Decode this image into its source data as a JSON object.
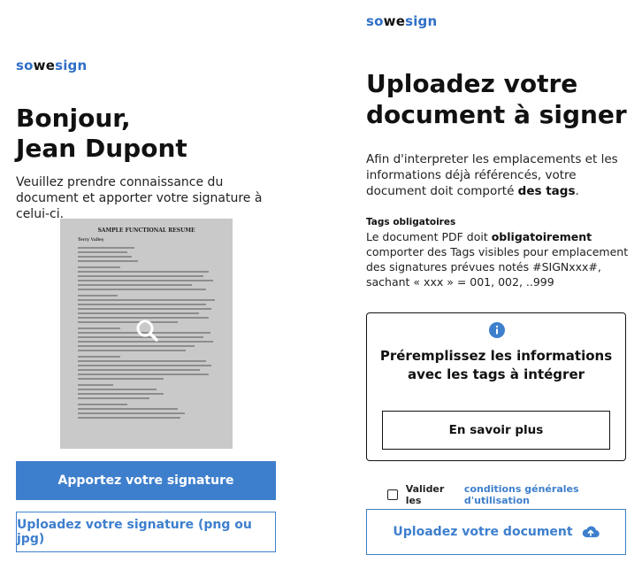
{
  "left": {
    "logo": {
      "so": "so",
      "we": "we",
      "sign": "sign"
    },
    "greeting_line1": "Bonjour,",
    "greeting_line2": "Jean Dupont",
    "intro": "Veuillez prendre connaissance du document et apporter votre signature à celui-ci.",
    "doc_preview": {
      "title": "SAMPLE FUNCTIONAL RESUME",
      "name": "Terry Valley"
    },
    "btn_sign": "Apportez votre signature",
    "btn_upload_signature": "Uploadez votre signature (png ou jpg)"
  },
  "right": {
    "logo": {
      "so": "so",
      "we": "we",
      "sign": "sign"
    },
    "heading_line1": "Uploadez votre",
    "heading_line2": "document à signer",
    "body_part1": "Afin d'interpreter les emplacements et les informations déjà référencés, votre document doit comporté ",
    "body_bold": "des tags",
    "body_end": ".",
    "tags_title": "Tags obligatoires",
    "tags_part1": "Le document PDF doit ",
    "tags_bold": "obligatoirement",
    "tags_part2": " comporter des Tags visibles pour emplacement des signatures prévues notés #SIGNxxx#, sachant  « xxx » = 001, 002, ..999",
    "card": {
      "title_line1": "Préremplissez les informations",
      "title_line2": "avec les tags à intégrer",
      "btn_more": "En savoir plus"
    },
    "cgu_prefix": "Valider les",
    "cgu_link": "conditions générales d'utilisation",
    "btn_upload_document": "Uploadez votre document"
  },
  "colors": {
    "brand_blue": "#3e7fcd",
    "logo_blue": "#2f6fc7",
    "text_dark": "#111111",
    "preview_gray": "#c9c9c9"
  },
  "icons": [
    "search-icon",
    "info-icon",
    "cloud-upload-icon"
  ]
}
